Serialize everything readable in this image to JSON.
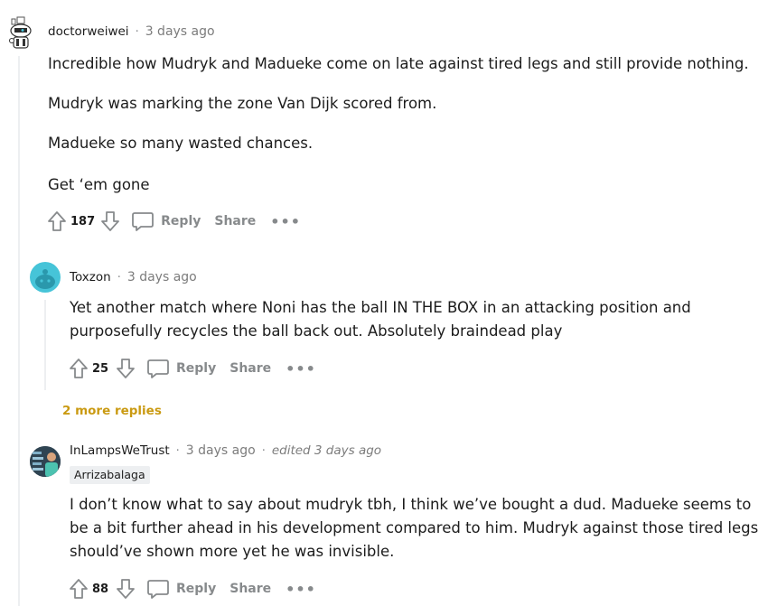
{
  "comments": [
    {
      "author": "doctorweiwei",
      "time": "3 days ago",
      "paragraphs": [
        "Incredible how Mudryk and Madueke come on late against tired legs and still provide nothing.",
        "Mudryk was marking the zone Van Dijk scored from.",
        "Madueke so many wasted chances.",
        "Get ‘em gone"
      ],
      "votes": "187",
      "reply_label": "Reply",
      "share_label": "Share",
      "more_label": "•••"
    },
    {
      "author": "Toxzon",
      "time": "3 days ago",
      "paragraphs": [
        "Yet another match where Noni has the ball IN THE BOX in an attacking position and purposefully recycles the ball back out. Absolutely braindead play"
      ],
      "votes": "25",
      "reply_label": "Reply",
      "share_label": "Share",
      "more_label": "•••"
    },
    {
      "author": "InLampsWeTrust",
      "time": "3 days ago",
      "edited": "edited 3 days ago",
      "flair": "Arrizabalaga",
      "paragraphs": [
        "I don’t know what to say about mudryk tbh, I think we’ve bought a dud. Madueke seems to be a bit further ahead in his development compared to him. Mudryk against those tired legs should’ve shown more yet he was invisible."
      ],
      "votes": "88",
      "reply_label": "Reply",
      "share_label": "Share",
      "more_label": "•••"
    }
  ],
  "more_replies": "2 more replies",
  "separator": "·",
  "colors": {
    "thread_line": "#edeff1",
    "action_gray": "#878a8c",
    "more_replies": "#ca9a12",
    "avatar_teal": "#46c4d8"
  },
  "icons": [
    "snoo-avatar-icon",
    "upvote-icon",
    "downvote-icon",
    "comment-icon"
  ]
}
